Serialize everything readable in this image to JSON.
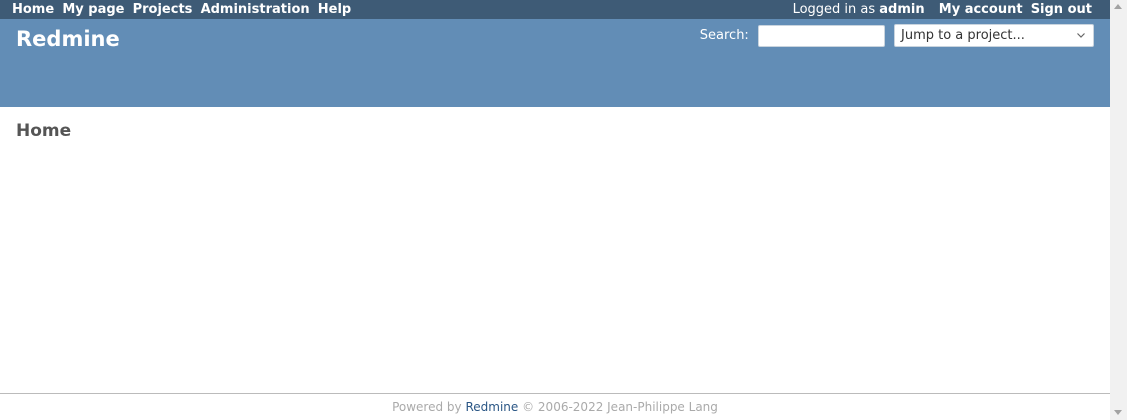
{
  "top_menu": {
    "items": [
      "Home",
      "My page",
      "Projects",
      "Administration",
      "Help"
    ],
    "logged_as_prefix": "Logged in as",
    "username": "admin",
    "my_account": "My account",
    "sign_out": "Sign out"
  },
  "header": {
    "app_title": "Redmine",
    "search_label": "Search:",
    "search_value": "",
    "jump_placeholder": "Jump to a project..."
  },
  "main": {
    "title": "Home"
  },
  "footer": {
    "powered_by": "Powered by",
    "link_text": "Redmine",
    "copyright": "© 2006-2022 Jean-Philippe Lang"
  },
  "colors": {
    "top_menu_bg": "#3e5b76",
    "header_bg": "#628db6",
    "footer_link": "#2a5685"
  },
  "icons": {
    "jump_chevron": "chevron-down-icon",
    "scroll_up": "scroll-up-arrow-icon",
    "scroll_down": "scroll-down-arrow-icon"
  }
}
